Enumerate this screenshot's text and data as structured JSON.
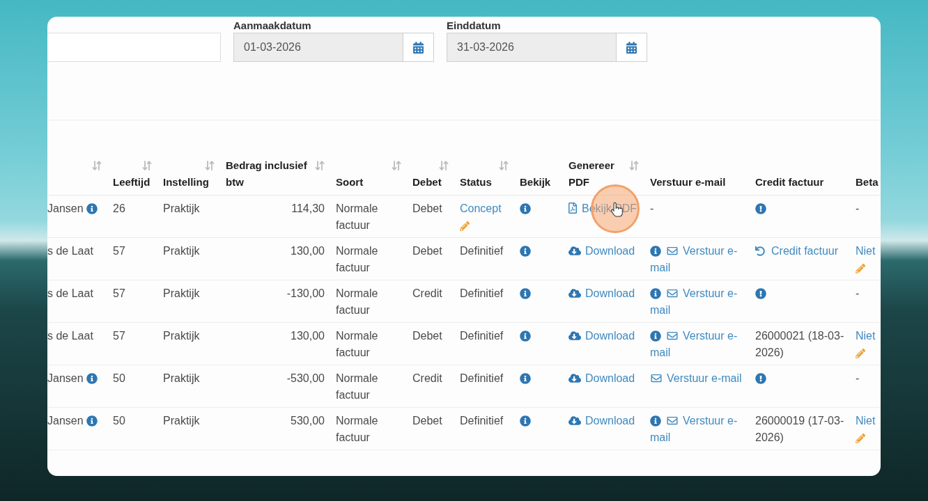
{
  "filters": [
    {
      "kind": "text"
    },
    {
      "kind": "date",
      "label": "Aanmaakdatum",
      "value": "01-03-2026"
    },
    {
      "kind": "date",
      "label": "Einddatum",
      "value": "31-03-2026"
    }
  ],
  "table": {
    "columns": [
      {
        "sortable": true
      },
      {
        "label": "Leeftijd",
        "sortable": true
      },
      {
        "label": "Instelling",
        "sortable": true
      },
      {
        "label": "Bedrag inclusief btw",
        "sortable": true
      },
      {
        "label": "Soort",
        "sortable": true
      },
      {
        "label": "Debet",
        "sortable": true
      },
      {
        "label": "Status",
        "sortable": true
      },
      {
        "label": "Bekijk",
        "sortable": false
      },
      {
        "label": "Genereer PDF",
        "sortable": true
      },
      {
        "label": "Verstuur e-mail",
        "sortable": false
      },
      {
        "label": "Credit factuur",
        "sortable": false
      },
      {
        "label": "Beta",
        "sortable": false
      }
    ],
    "rows": [
      {
        "client": {
          "name": "Jansen",
          "info": true
        },
        "age": "26",
        "institution": "Praktijk",
        "amount": "114,30",
        "type": "Normale factuur",
        "entry": "Debet",
        "status": {
          "label": "Concept",
          "editable": true
        },
        "pdf": {
          "kind": "view",
          "label": "Bekijk PDF",
          "clicked": true
        },
        "email": {
          "kind": "text",
          "label": "-",
          "info": false
        },
        "credit": {
          "kind": "warning"
        },
        "paid": {
          "label": "-",
          "editable": false
        }
      },
      {
        "client": {
          "name": "s de Laat",
          "info": false
        },
        "age": "57",
        "institution": "Praktijk",
        "amount": "130,00",
        "type": "Normale factuur",
        "entry": "Debet",
        "status": {
          "label": "Definitief",
          "editable": false
        },
        "pdf": {
          "kind": "download",
          "label": "Download",
          "clicked": false
        },
        "email": {
          "kind": "link",
          "label": "Verstuur e-mail",
          "info": true
        },
        "credit": {
          "kind": "link",
          "label": "Credit factuur"
        },
        "paid": {
          "label": "Niet",
          "editable": true
        }
      },
      {
        "client": {
          "name": "s de Laat",
          "info": false
        },
        "age": "57",
        "institution": "Praktijk",
        "amount": "-130,00",
        "type": "Normale factuur",
        "entry": "Credit",
        "status": {
          "label": "Definitief",
          "editable": false
        },
        "pdf": {
          "kind": "download",
          "label": "Download",
          "clicked": false
        },
        "email": {
          "kind": "link",
          "label": "Verstuur e-mail",
          "info": true
        },
        "credit": {
          "kind": "warning"
        },
        "paid": {
          "label": "-",
          "editable": false
        }
      },
      {
        "client": {
          "name": "s de Laat",
          "info": false
        },
        "age": "57",
        "institution": "Praktijk",
        "amount": "130,00",
        "type": "Normale factuur",
        "entry": "Debet",
        "status": {
          "label": "Definitief",
          "editable": false
        },
        "pdf": {
          "kind": "download",
          "label": "Download",
          "clicked": false
        },
        "email": {
          "kind": "link",
          "label": "Verstuur e-mail",
          "info": true
        },
        "credit": {
          "kind": "text",
          "label": "26000021 (18-03-2026)"
        },
        "paid": {
          "label": "Niet",
          "editable": true
        }
      },
      {
        "client": {
          "name": "Jansen",
          "info": true
        },
        "age": "50",
        "institution": "Praktijk",
        "amount": "-530,00",
        "type": "Normale factuur",
        "entry": "Credit",
        "status": {
          "label": "Definitief",
          "editable": false
        },
        "pdf": {
          "kind": "download",
          "label": "Download",
          "clicked": false
        },
        "email": {
          "kind": "link",
          "label": "Verstuur e-mail",
          "info": false
        },
        "credit": {
          "kind": "warning"
        },
        "paid": {
          "label": "-",
          "editable": false
        }
      },
      {
        "client": {
          "name": "Jansen",
          "info": true
        },
        "age": "50",
        "institution": "Praktijk",
        "amount": "530,00",
        "type": "Normale factuur",
        "entry": "Debet",
        "status": {
          "label": "Definitief",
          "editable": false
        },
        "pdf": {
          "kind": "download",
          "label": "Download",
          "clicked": false
        },
        "email": {
          "kind": "link",
          "label": "Verstuur e-mail",
          "info": true
        },
        "credit": {
          "kind": "text",
          "label": "26000019 (17-03-2026)"
        },
        "paid": {
          "label": "Niet",
          "editable": true
        }
      }
    ]
  }
}
